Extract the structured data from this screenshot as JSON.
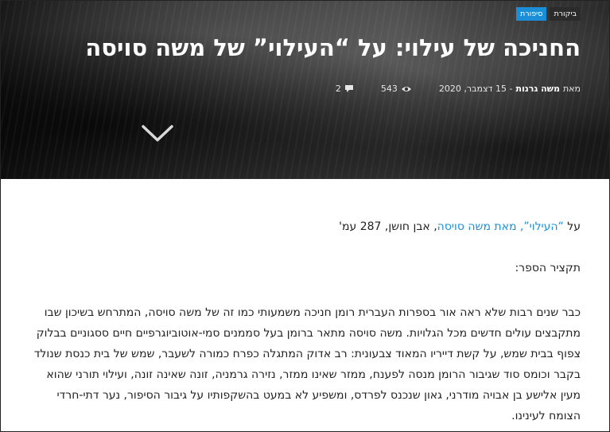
{
  "tags": {
    "fiction": "סיפורת",
    "review": "ביקורת"
  },
  "title": "החניכה של עילוי: על “העילוי” של משה סויסה",
  "meta": {
    "by": "מאת",
    "author": "משה גרנות",
    "date": "- 15 דצמבר, 2020",
    "views": "543",
    "comments": "2"
  },
  "article": {
    "intro_prefix": "על ",
    "intro_link": "“העילוי”, מאת משה סויסה",
    "intro_suffix": ", אבן חושן, 287 עמ'",
    "summary_heading": "תקציר הספר:",
    "summary_text": "כבר שנים רבות שלא ראה אור בספרות העברית רומן חניכה משמעותי כמו זה של משה סויסה, המתרחש בשיכון שבו מתקבצים עולים חדשים מכל הגלויות. משה סויסה מתאר ברומן בעל סממנים סמי-אוטוביוגרפיים חיים ססגוניים בבלוק צפוף בבית שמש, על קשת דייריו המאוד צבעונית: רב אדוק המתגלה כפרח כמורה לשעבר, שמש של בית כנסת שנולד בקבר וכומס סוד שגיבור הרומן מנסה לפענח, ממזר שאינו ממזר, נזירה גרמניה, זונה שאינה זונה, ועילוי תורני שהוא מעין אלישע בן אבויה מודרני, גאון שנכנס לפרדס, ומשפיע לא במעט בהשקפותיו על גיבור הסיפור, נער דתי-חרדי הצומח לעינינו."
  }
}
